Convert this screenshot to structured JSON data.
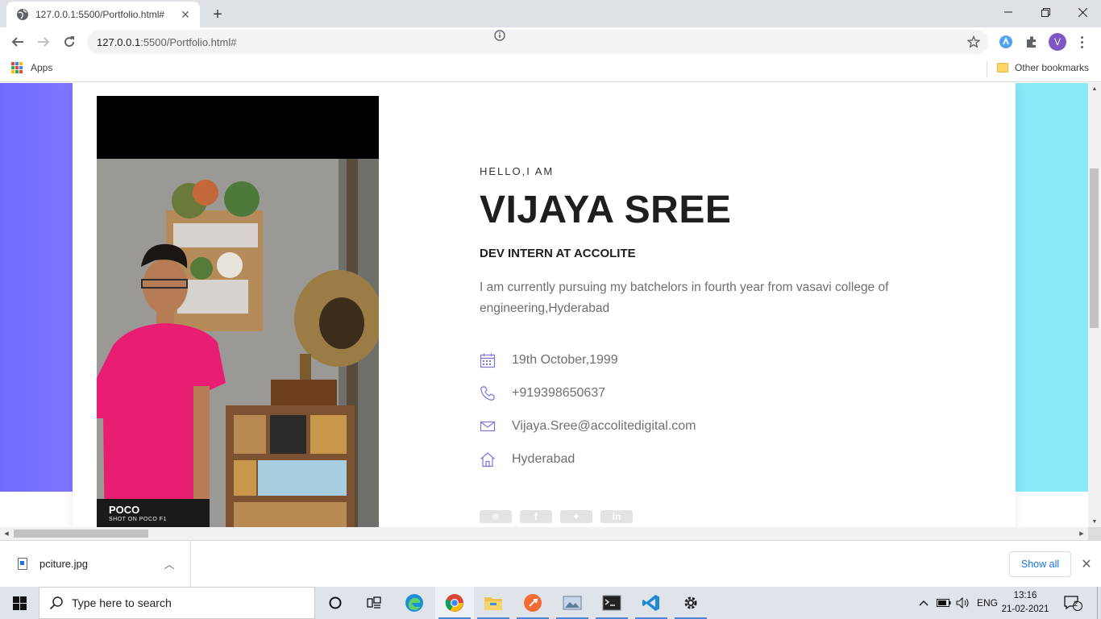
{
  "browser": {
    "tab_title": "127.0.0.1:5500/Portfolio.html#",
    "url_host": "127.0.0.1",
    "url_rest": ":5500/Portfolio.html#",
    "profile_initial": "V",
    "bookmarks": {
      "apps_label": "Apps",
      "other_label": "Other bookmarks"
    }
  },
  "profile": {
    "greeting": "HELLO,I AM",
    "name": "VIJAYA SREE",
    "role": "DEV INTERN AT ACCOLITE",
    "bio": "I am currently pursuing my batchelors in fourth year from vasavi college of engineering,Hyderabad",
    "contacts": [
      {
        "icon": "calendar-icon",
        "text": "19th October,1999"
      },
      {
        "icon": "phone-icon",
        "text": "+919398650637"
      },
      {
        "icon": "mail-icon",
        "text": "Vijaya.Sree@accolitedigital.com"
      },
      {
        "icon": "home-icon",
        "text": "Hyderabad"
      }
    ],
    "socials": [
      "github-icon",
      "facebook-icon",
      "twitter-icon",
      "linkedin-icon"
    ],
    "photo_watermark": "POCO",
    "photo_watermark_sub": "SHOT ON POCO F1"
  },
  "downloads": {
    "file_name": "pciture.jpg",
    "show_all_label": "Show all"
  },
  "taskbar": {
    "search_placeholder": "Type here to search",
    "language": "ENG",
    "time": "13:16",
    "date": "21-02-2021",
    "notification_count": "2"
  },
  "colors": {
    "left_gradient": "#6e6cff",
    "right_band": "#87e9f6",
    "icon_accent": "#7b74e0",
    "shirt_pink": "#e81e73"
  }
}
